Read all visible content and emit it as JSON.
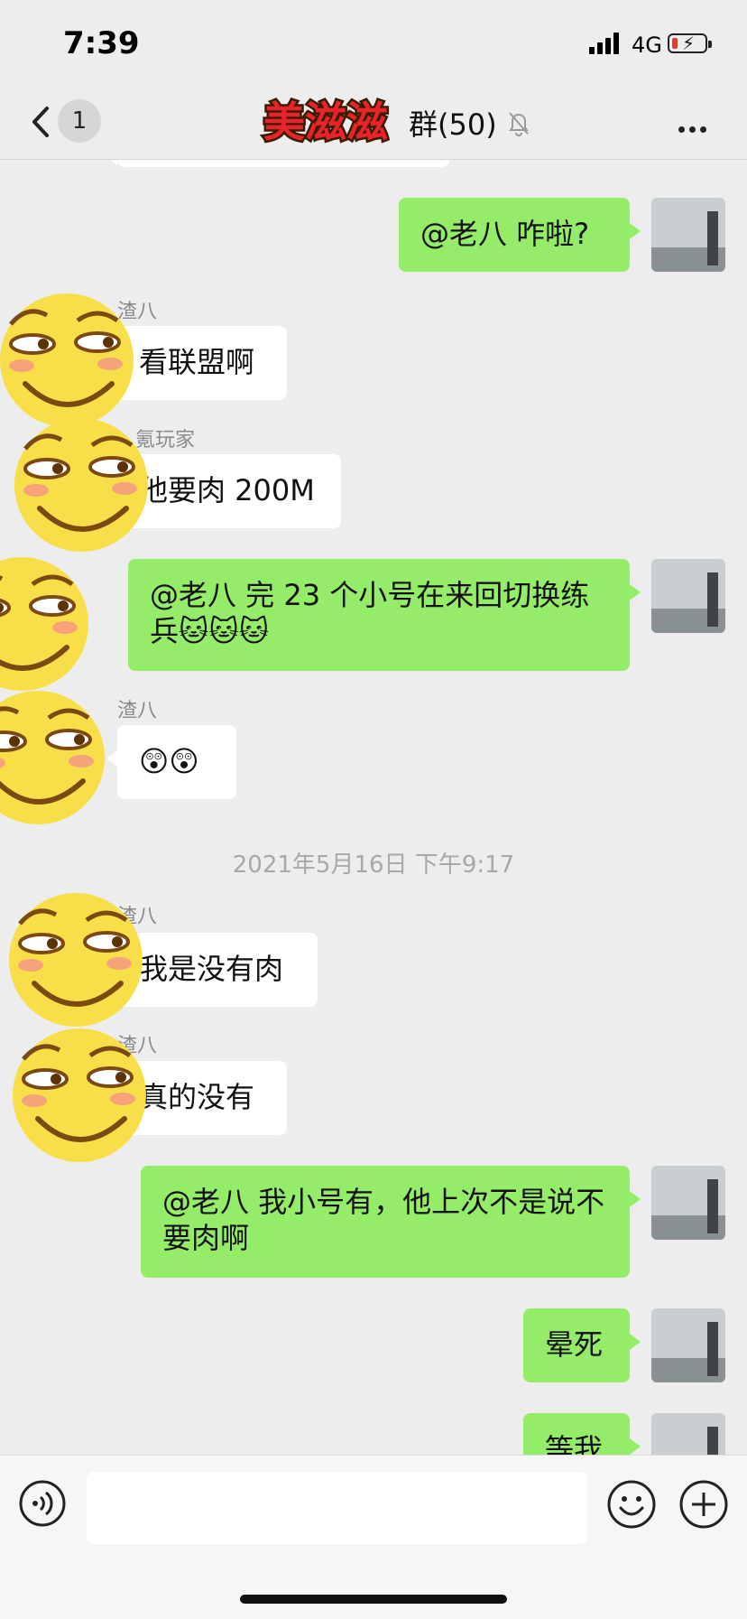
{
  "status_bar": {
    "time": "7:39",
    "network": "4G"
  },
  "nav": {
    "unread_count": "1",
    "title_logo_text": "美滋滋",
    "title_tail": "群(50)"
  },
  "messages": [
    {
      "id": "m1",
      "dir": "out",
      "text": "@老八 咋啦?"
    },
    {
      "id": "m2",
      "dir": "in",
      "sender": "渣八",
      "text": "看联盟啊"
    },
    {
      "id": "m3",
      "dir": "in",
      "sender": "氪玩家",
      "text": "他要肉 200M"
    },
    {
      "id": "m4",
      "dir": "out",
      "text": "@老八 完 23 个小号在来回切换练兵🐱🐱🐱"
    },
    {
      "id": "m5",
      "dir": "in",
      "sender": "渣八",
      "text": "😲😲"
    },
    {
      "id": "m6",
      "dir": "in",
      "sender": "渣八",
      "text": "我是没有肉"
    },
    {
      "id": "m7",
      "dir": "in",
      "sender": "渣八",
      "text": "真的没有"
    },
    {
      "id": "m8",
      "dir": "out",
      "text": "@老八 我小号有，他上次不是说不要肉啊"
    },
    {
      "id": "m9",
      "dir": "out",
      "text": "晕死"
    },
    {
      "id": "m10",
      "dir": "out",
      "text": "等我"
    }
  ],
  "timestamp": "2021年5月16日 下午9:17",
  "input_bar": {
    "placeholder": ""
  },
  "colors": {
    "background": "#ededed",
    "outgoing_bubble": "#95ec69",
    "incoming_bubble": "#ffffff",
    "face": "#f8df4a"
  },
  "icons": [
    "back-icon",
    "mute-icon",
    "more-icon",
    "voice-icon",
    "emoji-icon",
    "plus-icon",
    "cat-emoji",
    "shocked-emoji"
  ]
}
